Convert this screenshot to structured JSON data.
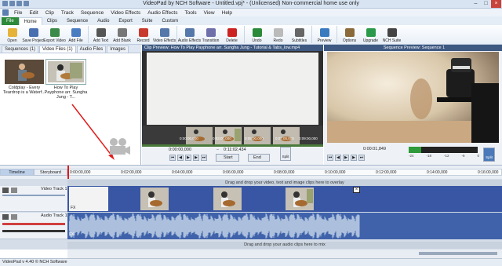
{
  "window": {
    "title": "VideoPad by NCH Software - Untitled.vpj* - (Unlicensed) Non-commercial home use only"
  },
  "menu": [
    "File",
    "Edit",
    "Clip",
    "Track",
    "Sequence",
    "Video Effects",
    "Audio Effects",
    "Tools",
    "View",
    "Help"
  ],
  "ribbon_tabs": [
    "File",
    "Home",
    "Clips",
    "Sequence",
    "Audio",
    "Export",
    "Suite",
    "Custom"
  ],
  "toolbar": [
    {
      "label": "Open",
      "icon": "folder-icon",
      "color": "#e6b33a"
    },
    {
      "label": "Save Project",
      "icon": "save-icon",
      "color": "#4a6fb0"
    },
    {
      "label": "Export Video",
      "icon": "export-icon",
      "color": "#3c8a4a"
    },
    {
      "label": "Add File",
      "icon": "add-file-icon",
      "color": "#4a7cc2"
    },
    {
      "label": "Add Text",
      "icon": "text-icon",
      "color": "#555555"
    },
    {
      "label": "Add Blank",
      "icon": "blank-icon",
      "color": "#777777"
    },
    {
      "label": "Record",
      "icon": "record-icon",
      "color": "#c83a2e"
    },
    {
      "label": "Video Effects",
      "icon": "video-effects-icon",
      "color": "#5577aa"
    },
    {
      "label": "Audio Effects",
      "icon": "audio-effects-icon",
      "color": "#5577aa"
    },
    {
      "label": "Transition",
      "icon": "transition-icon",
      "color": "#6f6faa"
    },
    {
      "label": "Delete",
      "icon": "delete-icon",
      "color": "#cc2222"
    },
    {
      "label": "Undo",
      "icon": "undo-icon",
      "color": "#2a8a3a"
    },
    {
      "label": "Redo",
      "icon": "redo-icon",
      "color": "#bbbbbb"
    },
    {
      "label": "Subtitles",
      "icon": "subtitles-icon",
      "color": "#666666"
    },
    {
      "label": "Preview",
      "icon": "preview-icon",
      "color": "#3a7abf"
    },
    {
      "label": "Options",
      "icon": "options-icon",
      "color": "#8a6a3a"
    },
    {
      "label": "Upgrade",
      "icon": "upgrade-icon",
      "color": "#2a9a4a"
    },
    {
      "label": "NCH Suite",
      "icon": "nch-suite-icon",
      "color": "#444444"
    }
  ],
  "media_tabs": [
    "Sequences (1)",
    "Video Files (1)",
    "Audio Files",
    "Images"
  ],
  "media_items": [
    {
      "caption": "Coldplay - Every Teardrop is a Waterf..."
    },
    {
      "caption": "How To Play Payphone arr. Sungha Jung - T..."
    }
  ],
  "clip_preview": {
    "title": "Clip Preview: How To Play Payphone arr. Sungha Jung - Tutorial & Tabs_low.mp4",
    "timecodes": [
      "0:00:00,000",
      "0:03:00,000",
      "0:05:00,000",
      "0:07:00,000",
      "0:09:00,000"
    ],
    "time_current": "0:00:00,000",
    "time_range": "0:11:02,434",
    "start_label": "Start",
    "end_label": "End",
    "split_label": "Split"
  },
  "sequence_preview": {
    "title": "Sequence Preview: Sequence 1",
    "time_current": "0:00:01,849",
    "time_start": "0:00:00,000",
    "meter_labels": [
      "-24",
      "-18",
      "-12",
      "-6",
      "0"
    ],
    "split_label": "Split"
  },
  "timeline": {
    "tabs": [
      "Timeline",
      "Storyboard"
    ],
    "ruler": [
      "0:00:00,000",
      "0:02:00,000",
      "0:04:00,000",
      "0:06:00,000",
      "0:08:00,000",
      "0:10:00,000",
      "0:12:00,000",
      "0:14:00,000",
      "0:16:00,000"
    ],
    "video_drop": "Drag and drop your video, text and image clips here to overlay",
    "audio_drop": "Drag and drop your audio clips here to mix",
    "video_track": "Video Track 1",
    "audio_track": "Audio Track 1"
  },
  "status": "VideoPad v 4.40 © NCH Software"
}
